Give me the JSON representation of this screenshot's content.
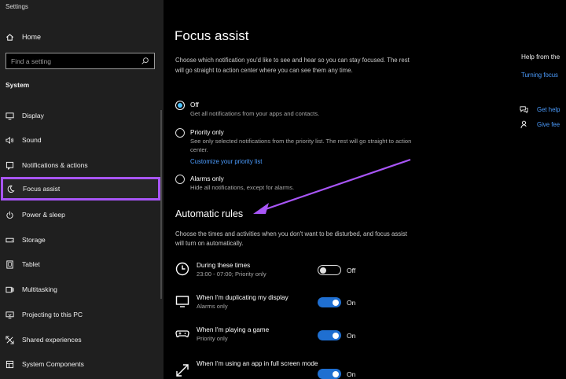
{
  "app": {
    "title": "Settings"
  },
  "sidebar": {
    "home_label": "Home",
    "search_placeholder": "Find a setting",
    "section": "System",
    "items": [
      {
        "label": "Display",
        "icon": "display-icon"
      },
      {
        "label": "Sound",
        "icon": "sound-icon"
      },
      {
        "label": "Notifications & actions",
        "icon": "notifications-icon"
      },
      {
        "label": "Focus assist",
        "icon": "moon-icon",
        "active": true
      },
      {
        "label": "Power & sleep",
        "icon": "power-icon"
      },
      {
        "label": "Storage",
        "icon": "storage-icon"
      },
      {
        "label": "Tablet",
        "icon": "tablet-icon"
      },
      {
        "label": "Multitasking",
        "icon": "multitasking-icon"
      },
      {
        "label": "Projecting to this PC",
        "icon": "projecting-icon"
      },
      {
        "label": "Shared experiences",
        "icon": "shared-icon"
      },
      {
        "label": "System Components",
        "icon": "components-icon"
      }
    ]
  },
  "main": {
    "title": "Focus assist",
    "description": "Choose which notification you'd like to see and hear so you can stay focused. The rest will go straight to action center where you can see them any time.",
    "options": [
      {
        "title": "Off",
        "desc": "Get all notifications from your apps and contacts.",
        "selected": true
      },
      {
        "title": "Priority only",
        "desc": "See only selected notifications from the priority list. The rest will go straight to action center.",
        "selected": false
      },
      {
        "title": "Alarms only",
        "desc": "Hide all notifications, except for alarms.",
        "selected": false
      }
    ],
    "priority_link": "Customize your priority list",
    "automatic_title": "Automatic rules",
    "automatic_desc": "Choose the times and activities when you don't want to be disturbed, and focus assist will turn on automatically.",
    "rules": [
      {
        "title": "During these times",
        "sub": "23:00 - 07:00; Priority only",
        "state": "Off",
        "icon": "clock-icon"
      },
      {
        "title": "When I'm duplicating my display",
        "sub": "Alarms only",
        "state": "On",
        "icon": "monitor-icon"
      },
      {
        "title": "When I'm playing a game",
        "sub": "Priority only",
        "state": "On",
        "icon": "gamepad-icon"
      },
      {
        "title": "When I'm using an app in full screen mode",
        "sub": "",
        "state": "On",
        "icon": "fullscreen-icon"
      }
    ]
  },
  "right": {
    "help_title": "Help from the",
    "help_link": "Turning focus",
    "get_help": "Get help",
    "give_feedback": "Give fee"
  },
  "colors": {
    "accent": "#1f6fd1",
    "highlight": "#a855f7",
    "link": "#4c9dff"
  }
}
